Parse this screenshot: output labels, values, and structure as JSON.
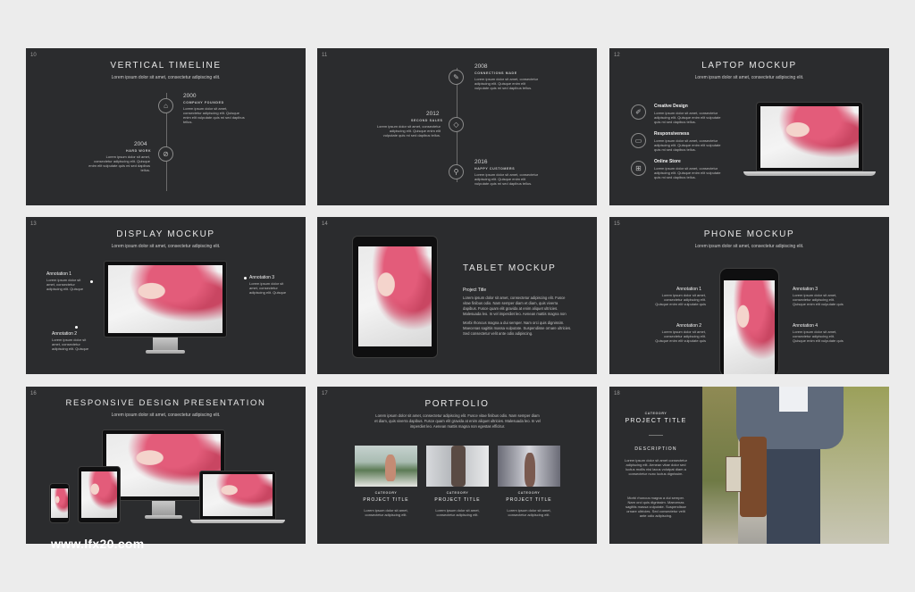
{
  "watermark": "www.lfx20.com",
  "lorem_sub": "Lorem ipsum dolor sit amet, consectetur adipiscing elit.",
  "lorem_small": "Lorem ipsum dolor sit amet, consectetur adipiscing elit. Quisque enim elit vulputate quis mi sed dapibus tellus.",
  "slides": {
    "s10": {
      "num": "10",
      "title": "VERTICAL TIMELINE",
      "items": [
        {
          "year": "2000",
          "caption": "COMPANY FOUNDED"
        },
        {
          "year": "2004",
          "caption": "HARD WORK"
        }
      ]
    },
    "s11": {
      "num": "11",
      "items": [
        {
          "year": "2008",
          "caption": "CONNECTIONS MADE"
        },
        {
          "year": "2012",
          "caption": "SECOND SALES"
        },
        {
          "year": "2016",
          "caption": "HAPPY CUSTOMERS"
        }
      ]
    },
    "s12": {
      "num": "12",
      "title": "LAPTOP MOCKUP",
      "features": [
        "Creative Design",
        "Responsiveness",
        "Online Store"
      ]
    },
    "s13": {
      "num": "13",
      "title": "DISPLAY MOCKUP",
      "annotations": [
        "Annotation 1",
        "Annotation 2",
        "Annotation 3"
      ]
    },
    "s14": {
      "num": "14",
      "title": "TABLET MOCKUP",
      "project": "Project Title"
    },
    "s15": {
      "num": "15",
      "title": "PHONE MOCKUP",
      "annotations": [
        "Annotation 1",
        "Annotation 2",
        "Annotation 3",
        "Annotation 4"
      ]
    },
    "s16": {
      "num": "16",
      "title": "RESPONSIVE DESIGN PRESENTATION"
    },
    "s17": {
      "num": "17",
      "title": "PORTFOLIO",
      "intro": "Lorem ipsum dolor sit amet, consectetur adipiscing elit. Fusce vitae finibus odio. Nam semper diam et diam, quis viverra dapibus. Fusce quam elit gravida at enim aliquet ultricies. Malesuada leo. In vel imperdiet leo. Aenean mattis magna non egestas efficitur.",
      "category": "CATEGORY",
      "project": "PROJECT TITLE",
      "desc": "Lorem ipsum dolor sit amet, consectetur adipiscing elit."
    },
    "s18": {
      "num": "18",
      "category": "CATEGORY",
      "title": "PROJECT TITLE",
      "desc_heading": "DESCRIPTION",
      "desc1": "Lorem ipsum dolor sit amet consectetur adipiscing elit. Aenean vitae dolor sed luctus mollis nisi lacus volutpat diam a consectetur nunc luctus dignissim.",
      "desc2": "Morbi rhoncus magna a dui semper. Nam orci quis dignissim. Maecenas sagittis massa vulputate. Suspendisse ornare ultricies. Sed consectetur velit ante odio adipiscing."
    }
  }
}
